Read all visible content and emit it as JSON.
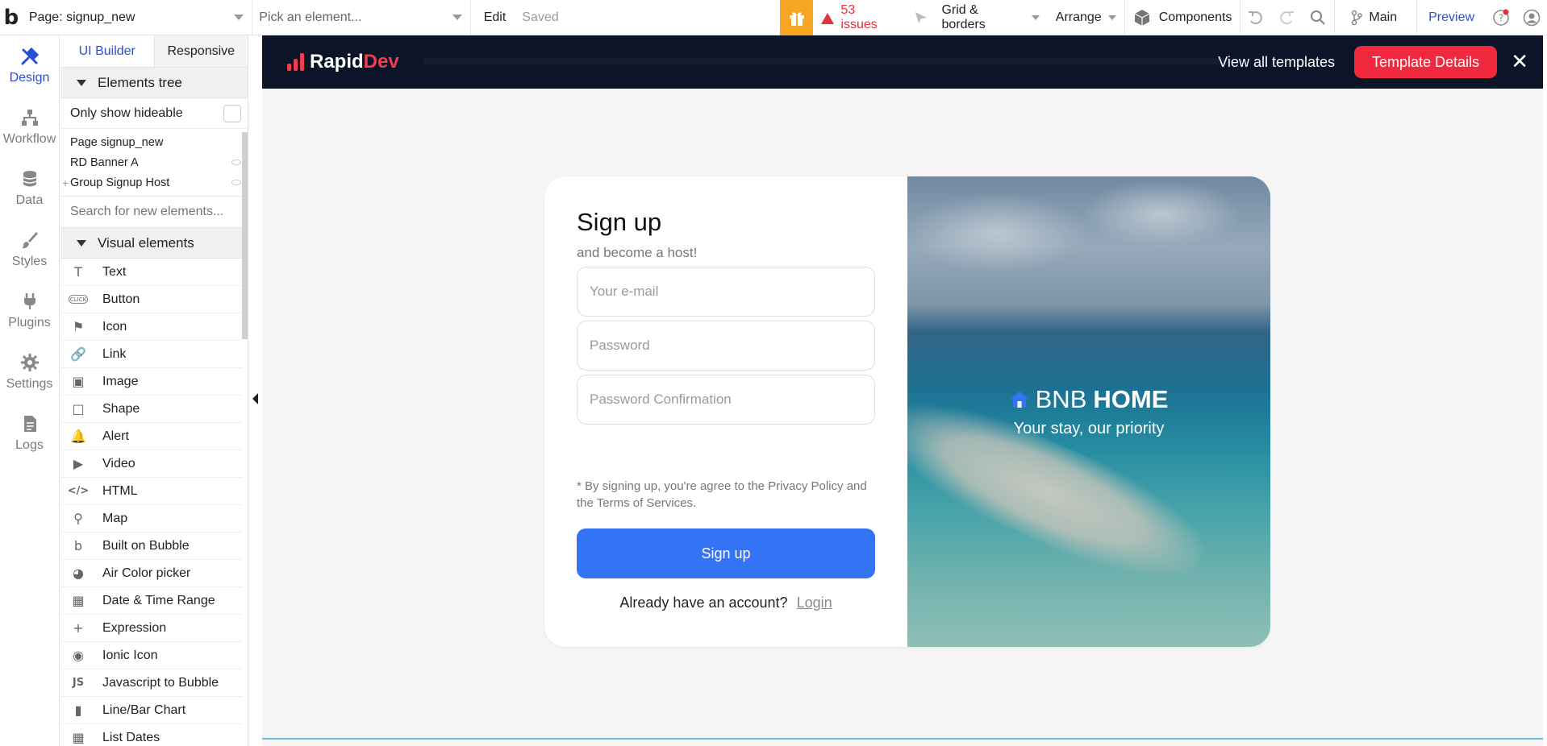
{
  "topbar": {
    "logo": "b",
    "page_select": "Page: signup_new",
    "element_picker": "Pick an element...",
    "edit": "Edit",
    "saved": "Saved",
    "issues": "53 issues",
    "grid_borders": "Grid & borders",
    "arrange": "Arrange",
    "components": "Components",
    "branch": "Main",
    "preview": "Preview"
  },
  "rail": {
    "design": "Design",
    "workflow": "Workflow",
    "data": "Data",
    "styles": "Styles",
    "plugins": "Plugins",
    "settings": "Settings",
    "logs": "Logs"
  },
  "panel": {
    "tab_builder": "UI Builder",
    "tab_responsive": "Responsive",
    "elements_tree": "Elements tree",
    "only_hideable": "Only show hideable",
    "tree": [
      "Page signup_new",
      "RD Banner A",
      "Group Signup Host"
    ],
    "search_placeholder": "Search for new elements...",
    "visual_elements": "Visual elements",
    "items": [
      {
        "label": "Text",
        "icon": "T"
      },
      {
        "label": "Button",
        "icon": "CLICK"
      },
      {
        "label": "Icon",
        "icon": "⚑"
      },
      {
        "label": "Link",
        "icon": "🔗"
      },
      {
        "label": "Image",
        "icon": "▣"
      },
      {
        "label": "Shape",
        "icon": "□"
      },
      {
        "label": "Alert",
        "icon": "🔔"
      },
      {
        "label": "Video",
        "icon": "▶"
      },
      {
        "label": "HTML",
        "icon": "</>"
      },
      {
        "label": "Map",
        "icon": "⚲"
      },
      {
        "label": "Built on Bubble",
        "icon": "b"
      },
      {
        "label": "Air Color picker",
        "icon": "◕"
      },
      {
        "label": "Date & Time Range",
        "icon": "▦"
      },
      {
        "label": "Expression",
        "icon": "+"
      },
      {
        "label": "Ionic Icon",
        "icon": "◉"
      },
      {
        "label": "Javascript to Bubble",
        "icon": "JS"
      },
      {
        "label": "Line/Bar Chart",
        "icon": "▮"
      },
      {
        "label": "List Dates",
        "icon": "▦"
      }
    ]
  },
  "banner": {
    "logo_rapid": "Rapid",
    "logo_dev": "Dev",
    "view_all": "View all templates",
    "template_details": "Template Details",
    "close": "✕"
  },
  "signup": {
    "title": "Sign up",
    "subtitle": "and become a host!",
    "email_placeholder": "Your e-mail",
    "password_placeholder": "Password",
    "confirm_placeholder": "Password Confirmation",
    "terms": "* By signing up, you're agree to the Privacy Policy and the Terms of Services.",
    "button": "Sign up",
    "already": "Already have an account?",
    "login": "Login"
  },
  "hero": {
    "brand_light": "BNB",
    "brand_bold": "HOME",
    "tagline": "Your stay, our priority"
  },
  "colors": {
    "accent": "#2a4fd6",
    "banner_bg": "#0c1527",
    "brand_red": "#f0293e",
    "signup_button": "#3573f5",
    "gift": "#f6a623"
  }
}
